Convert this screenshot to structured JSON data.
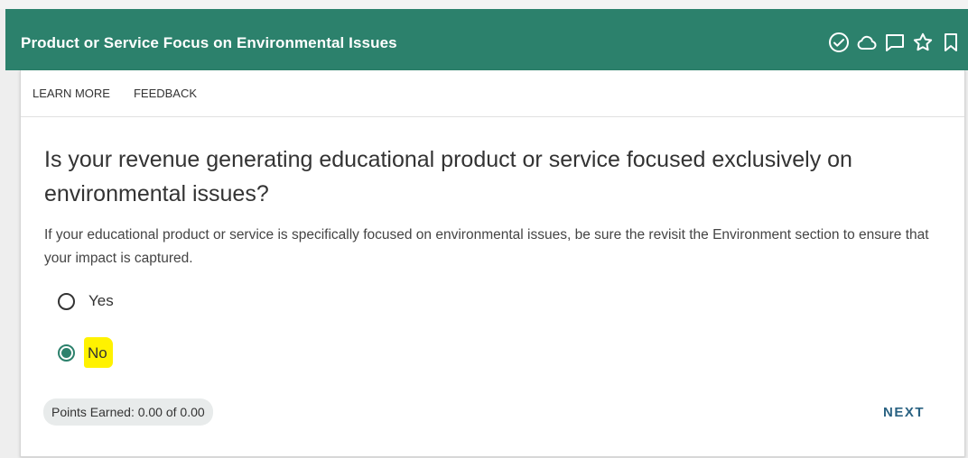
{
  "header": {
    "title": "Product or Service Focus on Environmental Issues",
    "icons": [
      "check-circle-icon",
      "cloud-icon",
      "comment-icon",
      "star-icon",
      "bookmark-icon"
    ]
  },
  "tabs": {
    "learn_more": "LEARN MORE",
    "feedback": "FEEDBACK"
  },
  "question": {
    "text": "Is your revenue generating educational product or service focused exclusively on environmental issues?",
    "help": "If your educational product or service is specifically focused on environmental issues, be sure the revisit the Environment section to ensure that your impact is captured."
  },
  "options": [
    {
      "label": "Yes",
      "selected": false
    },
    {
      "label": "No",
      "selected": true
    }
  ],
  "footer": {
    "points": "Points Earned: 0.00 of 0.00",
    "next": "NEXT"
  },
  "colors": {
    "header_bg": "#2c816c",
    "accent": "#2c816c",
    "highlight": "#fff200",
    "next_link": "#2a6282"
  }
}
